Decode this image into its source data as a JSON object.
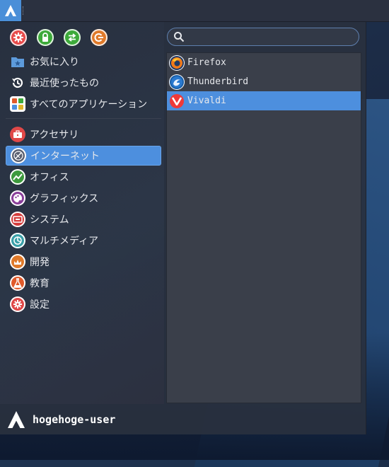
{
  "panel": {
    "logo_icon": "arch-logo-icon",
    "grip_icon": "drag-handle-icon"
  },
  "actions": [
    {
      "name": "settings",
      "icon": "gear-icon",
      "color": "#e84a4a"
    },
    {
      "name": "lock",
      "icon": "lock-icon",
      "color": "#3daa3a"
    },
    {
      "name": "switch-user",
      "icon": "switch-arrows-icon",
      "color": "#3daa3a"
    },
    {
      "name": "logout",
      "icon": "power-icon",
      "color": "#e07a2a"
    }
  ],
  "search": {
    "placeholder": "",
    "value": ""
  },
  "categories": {
    "favorites": {
      "label": "お気に入り",
      "icon": "folder-star-icon"
    },
    "recent": {
      "label": "最近使ったもの",
      "icon": "history-icon"
    },
    "all": {
      "label": "すべてのアプリケーション",
      "icon": "grid-apps-icon"
    },
    "accessories": {
      "label": "アクセサリ",
      "icon": "toolbox-icon",
      "color": "#e04848"
    },
    "internet": {
      "label": "インターネット",
      "icon": "globe-icon",
      "color": "#5a6070",
      "active": true
    },
    "office": {
      "label": "オフィス",
      "icon": "chart-line-icon",
      "color": "#3d9a3d"
    },
    "graphics": {
      "label": "グラフィックス",
      "icon": "palette-icon",
      "color": "#8a3f9a"
    },
    "system": {
      "label": "システム",
      "icon": "system-icon",
      "color": "#d43b3b"
    },
    "multimedia": {
      "label": "マルチメディア",
      "icon": "multimedia-icon",
      "color": "#3aa0a8"
    },
    "development": {
      "label": "開発",
      "icon": "development-icon",
      "color": "#e07a2a"
    },
    "education": {
      "label": "教育",
      "icon": "flask-icon",
      "color": "#e05a2a"
    },
    "settings": {
      "label": "設定",
      "icon": "settings-gear-icon",
      "color": "#e04848"
    }
  },
  "apps": [
    {
      "label": "Firefox",
      "icon": "firefox-icon"
    },
    {
      "label": "Thunderbird",
      "icon": "thunderbird-icon"
    },
    {
      "label": "Vivaldi",
      "icon": "vivaldi-icon",
      "selected": true
    }
  ],
  "user": {
    "name": "hogehoge-user",
    "icon": "arch-logo-icon"
  }
}
